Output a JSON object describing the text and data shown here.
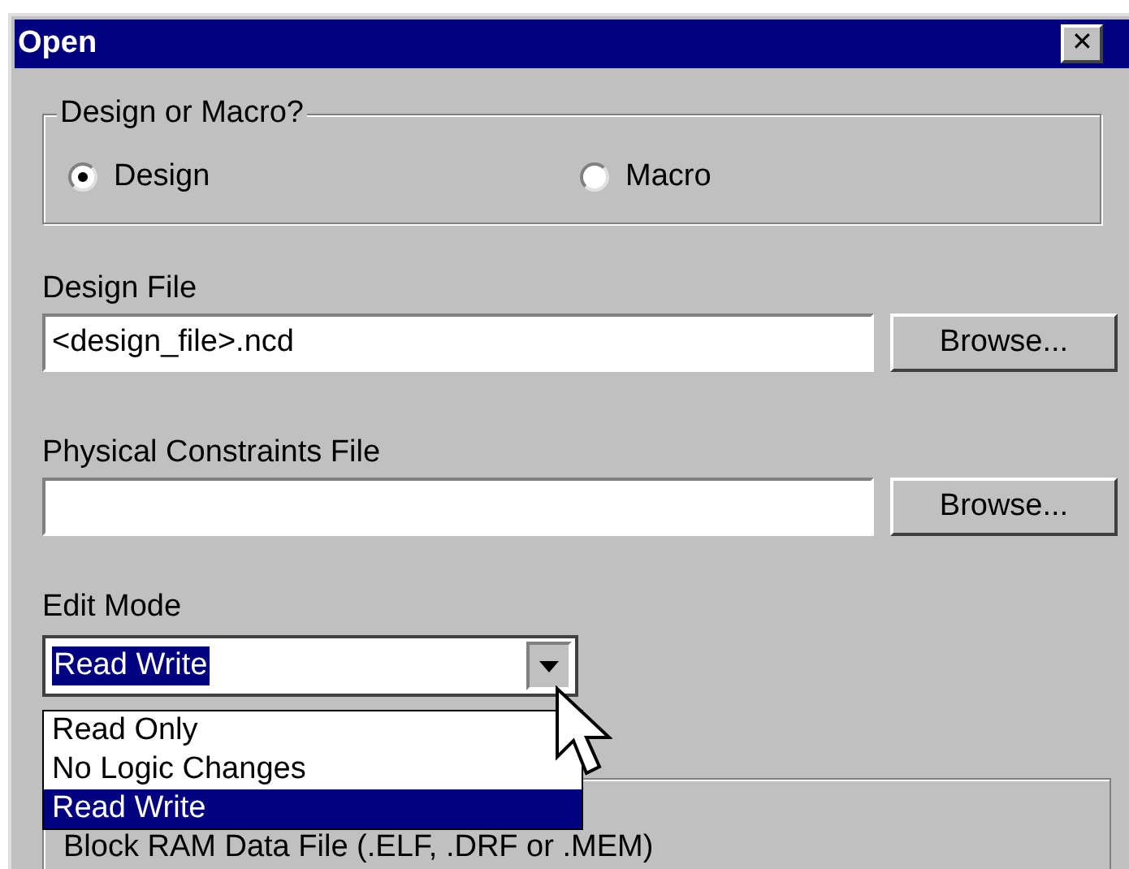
{
  "window": {
    "title": "Open",
    "close": "✕"
  },
  "source_group": {
    "label": "Design or Macro?",
    "options": [
      {
        "label": "Design",
        "selected": true
      },
      {
        "label": "Macro",
        "selected": false
      }
    ]
  },
  "design_file": {
    "label": "Design File",
    "value": "<design_file>.ncd",
    "button": "Browse..."
  },
  "physical_constraints_file": {
    "label": "Physical Constraints File",
    "button": "Browse..."
  },
  "edit_mode": {
    "label": "Edit Mode",
    "value": "Read Write",
    "options": [
      {
        "label": "Read Only",
        "selected": false
      },
      {
        "label": "No Logic Changes",
        "selected": false
      },
      {
        "label": "Read Write",
        "selected": true
      }
    ]
  },
  "block_ram_group": {
    "label": "Block RAM Data File (.ELF, .DRF or .MEM)"
  }
}
